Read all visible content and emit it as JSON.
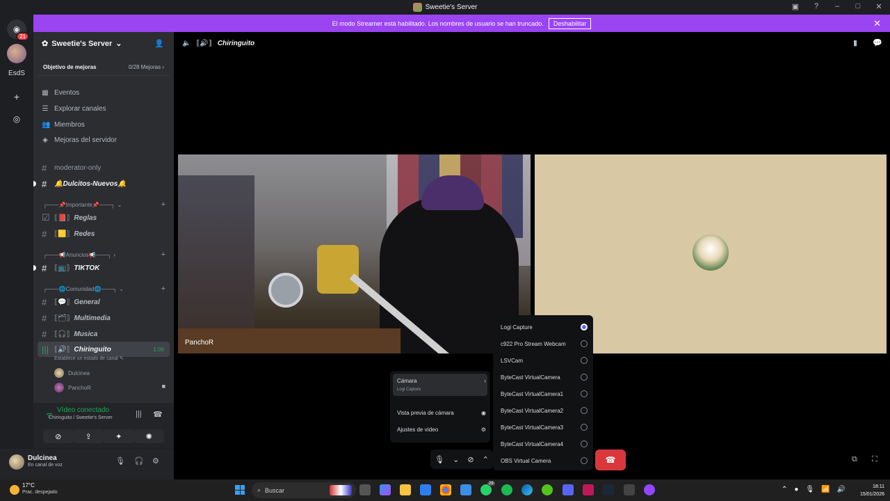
{
  "window": {
    "title": "Sweetie's Server",
    "controls": [
      "minimize",
      "maximize",
      "close"
    ]
  },
  "streamer_banner": {
    "text": "El modo Streamer está habilitado. Los nombres de usuario se han truncado.",
    "button": "Deshabilitar"
  },
  "guilds": {
    "dm_badge": "21",
    "server_label": "EsdS"
  },
  "server": {
    "name": "Sweetie's Server",
    "boost_goal_label": "Objetivo de mejoras",
    "boost_goal_count": "0/28 Mejoras",
    "nav": [
      {
        "icon": "calendar-icon",
        "label": "Eventos"
      },
      {
        "icon": "list-icon",
        "label": "Explorar canales"
      },
      {
        "icon": "members-icon",
        "label": "Miembros"
      },
      {
        "icon": "boost-icon",
        "label": "Mejoras del servidor"
      }
    ]
  },
  "channels": {
    "moderator": "moderator-only",
    "dulcitos": "🔔Dulcitos-Nuevos🔔",
    "cat_importante": "┌───📌Importante📌───┐",
    "reglas": "Reglas",
    "redes": "Redes",
    "cat_anuncios": "┌───📢Anuncios📢───┐",
    "tiktok": "TIKTOK",
    "cat_comunidad": "┌───🌐Comunidad🌐───┐",
    "general": "General",
    "multimedia": "Multimedia",
    "musica": "Musica",
    "chiringuito": "Chiringuito",
    "chiringuito_duration": "1:06",
    "status_hint": "Establece un estado de canal",
    "voice_users": [
      "Dulcinea",
      "PanchoR"
    ]
  },
  "voice_panel": {
    "status": "Vídeo conectado",
    "channel": "Chiringuito / Sweetie's Server"
  },
  "user": {
    "name": "Dulcinea",
    "status": "En canal de voz"
  },
  "main": {
    "channel_name": "Chiringuito",
    "camera_tile_name": "PanchoR"
  },
  "camera_devices": {
    "selected": "Logi Capture",
    "items": [
      "Logi Capture",
      "c922 Pro Stream Webcam",
      "LSVCam",
      "ByteCast VirtualCamera",
      "ByteCast VirtualCamera1",
      "ByteCast VirtualCamera2",
      "ByteCast VirtualCamera3",
      "ByteCast VirtualCamera4",
      "OBS Virtual Camera"
    ]
  },
  "camera_menu": {
    "camera_label": "Cámara",
    "camera_sub": "Logi Capture",
    "preview": "Vista previa de cámara",
    "settings": "Ajustes de vídeo"
  },
  "taskbar": {
    "temp": "17°C",
    "weather": "Prac. despejado",
    "search": "Buscar",
    "whatsapp_badge": "29",
    "time": "18:11",
    "date": "15/01/2026"
  },
  "colors": {
    "accent": "#9b44f2",
    "hangup": "#da373c",
    "connected": "#23a559",
    "blurple": "#5865f2"
  }
}
